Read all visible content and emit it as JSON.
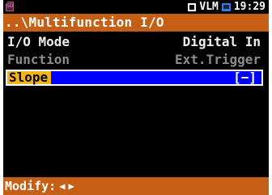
{
  "status": {
    "sd_icon_label": "SD",
    "mode_label": "VLM",
    "time": "19:29"
  },
  "title": "..\\Multifunction I/O",
  "rows": [
    {
      "label": "I/O Mode",
      "value": "Digital In"
    },
    {
      "label": "Function",
      "value": "Ext.Trigger"
    },
    {
      "label": "Slope",
      "value": "[−]"
    }
  ],
  "footer": {
    "label": "Modify:",
    "left_arrow": "◀",
    "right_arrow": "▶"
  },
  "colors": {
    "header_orange": "#c55f15",
    "selection_blue": "#0000ff",
    "selection_label_yellow": "#f3b417",
    "disabled_gray": "#8c8c8c"
  }
}
